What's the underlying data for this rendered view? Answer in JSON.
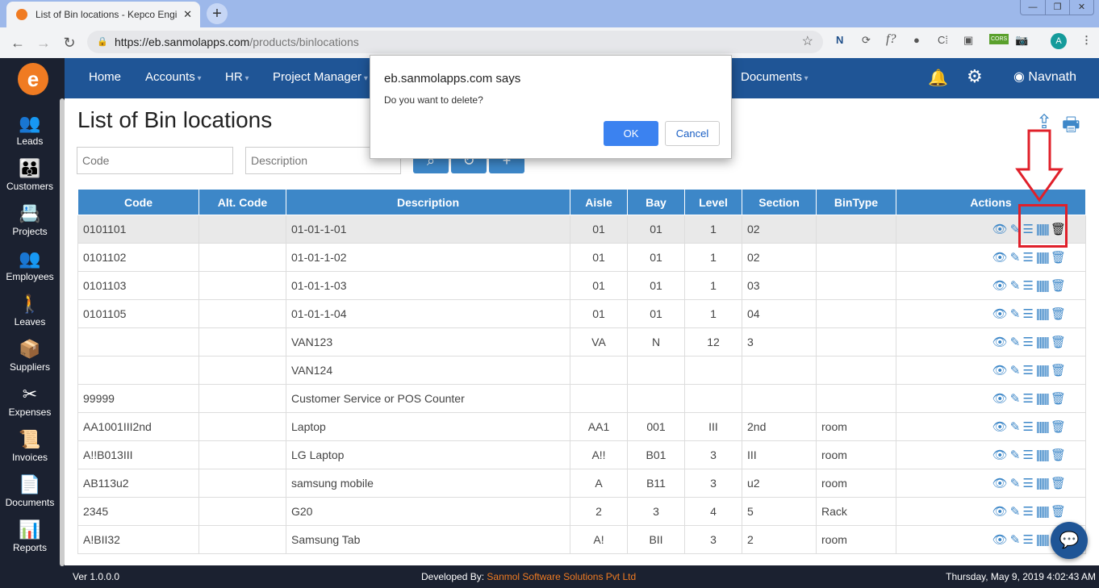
{
  "browser": {
    "tab_title": "List of Bin locations - Kepco Engi",
    "url_host": "https://eb.sanmolapps.com",
    "url_path": "/products/binlocations",
    "profile_initial": "A",
    "extensions": [
      "N",
      "⟳",
      "f?",
      "●",
      "C⁞",
      "▣",
      "CORS",
      "📷"
    ]
  },
  "sidebar": {
    "items": [
      {
        "label": "Leads",
        "icon": "👥"
      },
      {
        "label": "Customers",
        "icon": "👪"
      },
      {
        "label": "Projects",
        "icon": "📇"
      },
      {
        "label": "Employees",
        "icon": "👥"
      },
      {
        "label": "Leaves",
        "icon": "🚶"
      },
      {
        "label": "Suppliers",
        "icon": "📦"
      },
      {
        "label": "Expenses",
        "icon": "✂"
      },
      {
        "label": "Invoices",
        "icon": "📜"
      },
      {
        "label": "Documents",
        "icon": "📄"
      },
      {
        "label": "Reports",
        "icon": "📊"
      }
    ]
  },
  "topnav": {
    "items": [
      "Home",
      "Accounts",
      "HR",
      "Project Manager",
      "Documents"
    ],
    "user": "Navnath"
  },
  "page": {
    "title": "List of Bin locations",
    "code_placeholder": "Code",
    "description_placeholder": "Description"
  },
  "table": {
    "headers": [
      "Code",
      "Alt. Code",
      "Description",
      "Aisle",
      "Bay",
      "Level",
      "Section",
      "BinType",
      "Actions"
    ],
    "rows": [
      [
        "0101101",
        "",
        "01-01-1-01",
        "01",
        "01",
        "1",
        "02",
        ""
      ],
      [
        "0101102",
        "",
        "01-01-1-02",
        "01",
        "01",
        "1",
        "02",
        ""
      ],
      [
        "0101103",
        "",
        "01-01-1-03",
        "01",
        "01",
        "1",
        "03",
        ""
      ],
      [
        "0101105",
        "",
        "01-01-1-04",
        "01",
        "01",
        "1",
        "04",
        ""
      ],
      [
        "",
        "",
        "VAN123",
        "VA",
        "N",
        "12",
        "3",
        ""
      ],
      [
        "",
        "",
        "VAN124",
        "",
        "",
        "",
        "",
        ""
      ],
      [
        "99999",
        "",
        "Customer Service or POS Counter",
        "",
        "",
        "",
        "",
        ""
      ],
      [
        "AA1001III2nd",
        "",
        "Laptop",
        "AA1",
        "001",
        "III",
        "2nd",
        "room"
      ],
      [
        "A!!B013III",
        "",
        "LG Laptop",
        "A!!",
        "B01",
        "3",
        "III",
        "room"
      ],
      [
        "AB113u2",
        "",
        "samsung mobile",
        "A",
        "B11",
        "3",
        "u2",
        "room"
      ],
      [
        "2345",
        "",
        "G20",
        "2",
        "3",
        "4",
        "5",
        "Rack"
      ],
      [
        "A!BII32",
        "",
        "Samsung Tab",
        "A!",
        "BII",
        "3",
        "2",
        "room"
      ]
    ]
  },
  "dialog": {
    "title": "eb.sanmolapps.com says",
    "message": "Do you want to delete?",
    "ok": "OK",
    "cancel": "Cancel"
  },
  "footer": {
    "version": "Ver 1.0.0.0",
    "developed_by": "Developed By:",
    "company": "Sanmol Software Solutions Pvt Ltd",
    "datetime": "Thursday, May 9, 2019 4:02:43 AM"
  },
  "colors": {
    "nav": "#1f5596",
    "table_header": "#3d87c8",
    "sidebar": "#1b2130",
    "accent": "#f07b22",
    "highlight": "#e0202a"
  }
}
